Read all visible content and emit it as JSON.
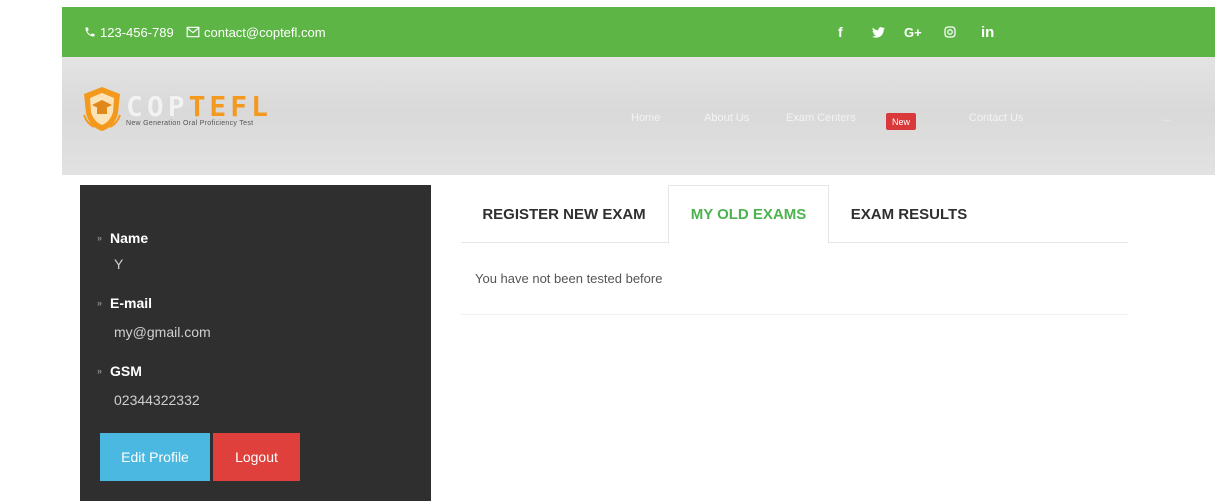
{
  "topbar": {
    "phone": "123-456-789",
    "email": "contact@coptefl.com",
    "social": [
      "f",
      "",
      "G+",
      "",
      "in"
    ],
    "icons": [
      "facebook-icon",
      "twitter-icon",
      "google-plus-icon",
      "instagram-icon",
      "linkedin-icon"
    ],
    "color": "#5cb545"
  },
  "header": {
    "logo": {
      "part1": "COP",
      "part2": "TEFL",
      "tagline": "New Generation Oral Proficiency Test"
    },
    "nav": [
      "Home",
      "About Us",
      "Exam Centers",
      "Contact Us",
      "..."
    ],
    "badge": "New"
  },
  "sidebar": {
    "name_label": "Name",
    "name_value": "Y",
    "email_label": "E-mail",
    "email_value": "my@gmail.com",
    "gsm_label": "GSM",
    "gsm_value": "02344322332",
    "edit_button": "Edit Profile",
    "logout_button": "Logout"
  },
  "tabs": [
    {
      "label": "REGISTER NEW EXAM",
      "active": false
    },
    {
      "label": "MY OLD EXAMS",
      "active": true
    },
    {
      "label": "EXAM RESULTS",
      "active": false
    }
  ],
  "content": {
    "message": "You have not been tested before"
  },
  "colors": {
    "accent_green": "#4db34f",
    "edit_blue": "#4ab8e0",
    "logout_red": "#e0403c",
    "sidebar_bg": "#2f2f2f",
    "logo_orange": "#f39a1e"
  }
}
